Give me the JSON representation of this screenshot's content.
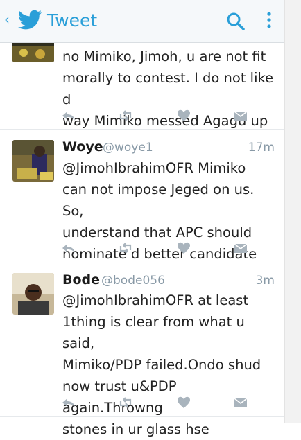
{
  "header": {
    "title": "Tweet",
    "icons": [
      "back-arrow-icon",
      "twitter-bird-icon",
      "search-icon",
      "overflow-menu-icon"
    ]
  },
  "tweets": [
    {
      "text_lines": [
        "no Mimiko, Jimoh, u are not fit",
        "morally to contest. I do not like d",
        "way Mimiko messed Agagu up"
      ]
    },
    {
      "name": "Woye",
      "handle": "@woye1",
      "time": "17m",
      "text_lines": [
        "@JimohIbrahimOFR Mimiko",
        "can not impose Jeged on us. So,",
        "understand that APC should",
        "nominate d better candidate"
      ]
    },
    {
      "name": "Bode",
      "handle": "@bode056",
      "time": "3m",
      "text_lines": [
        "@JimohIbrahimOFR at least",
        "1thing is clear from what u said,",
        "Mimiko/PDP failed.Ondo shud",
        "now trust u&PDP again.Throwng",
        "stones in ur glass hse"
      ]
    }
  ],
  "colors": {
    "accent": "#2a9fd8",
    "muted": "#8899a6",
    "action_icon": "#a9b4bd"
  }
}
